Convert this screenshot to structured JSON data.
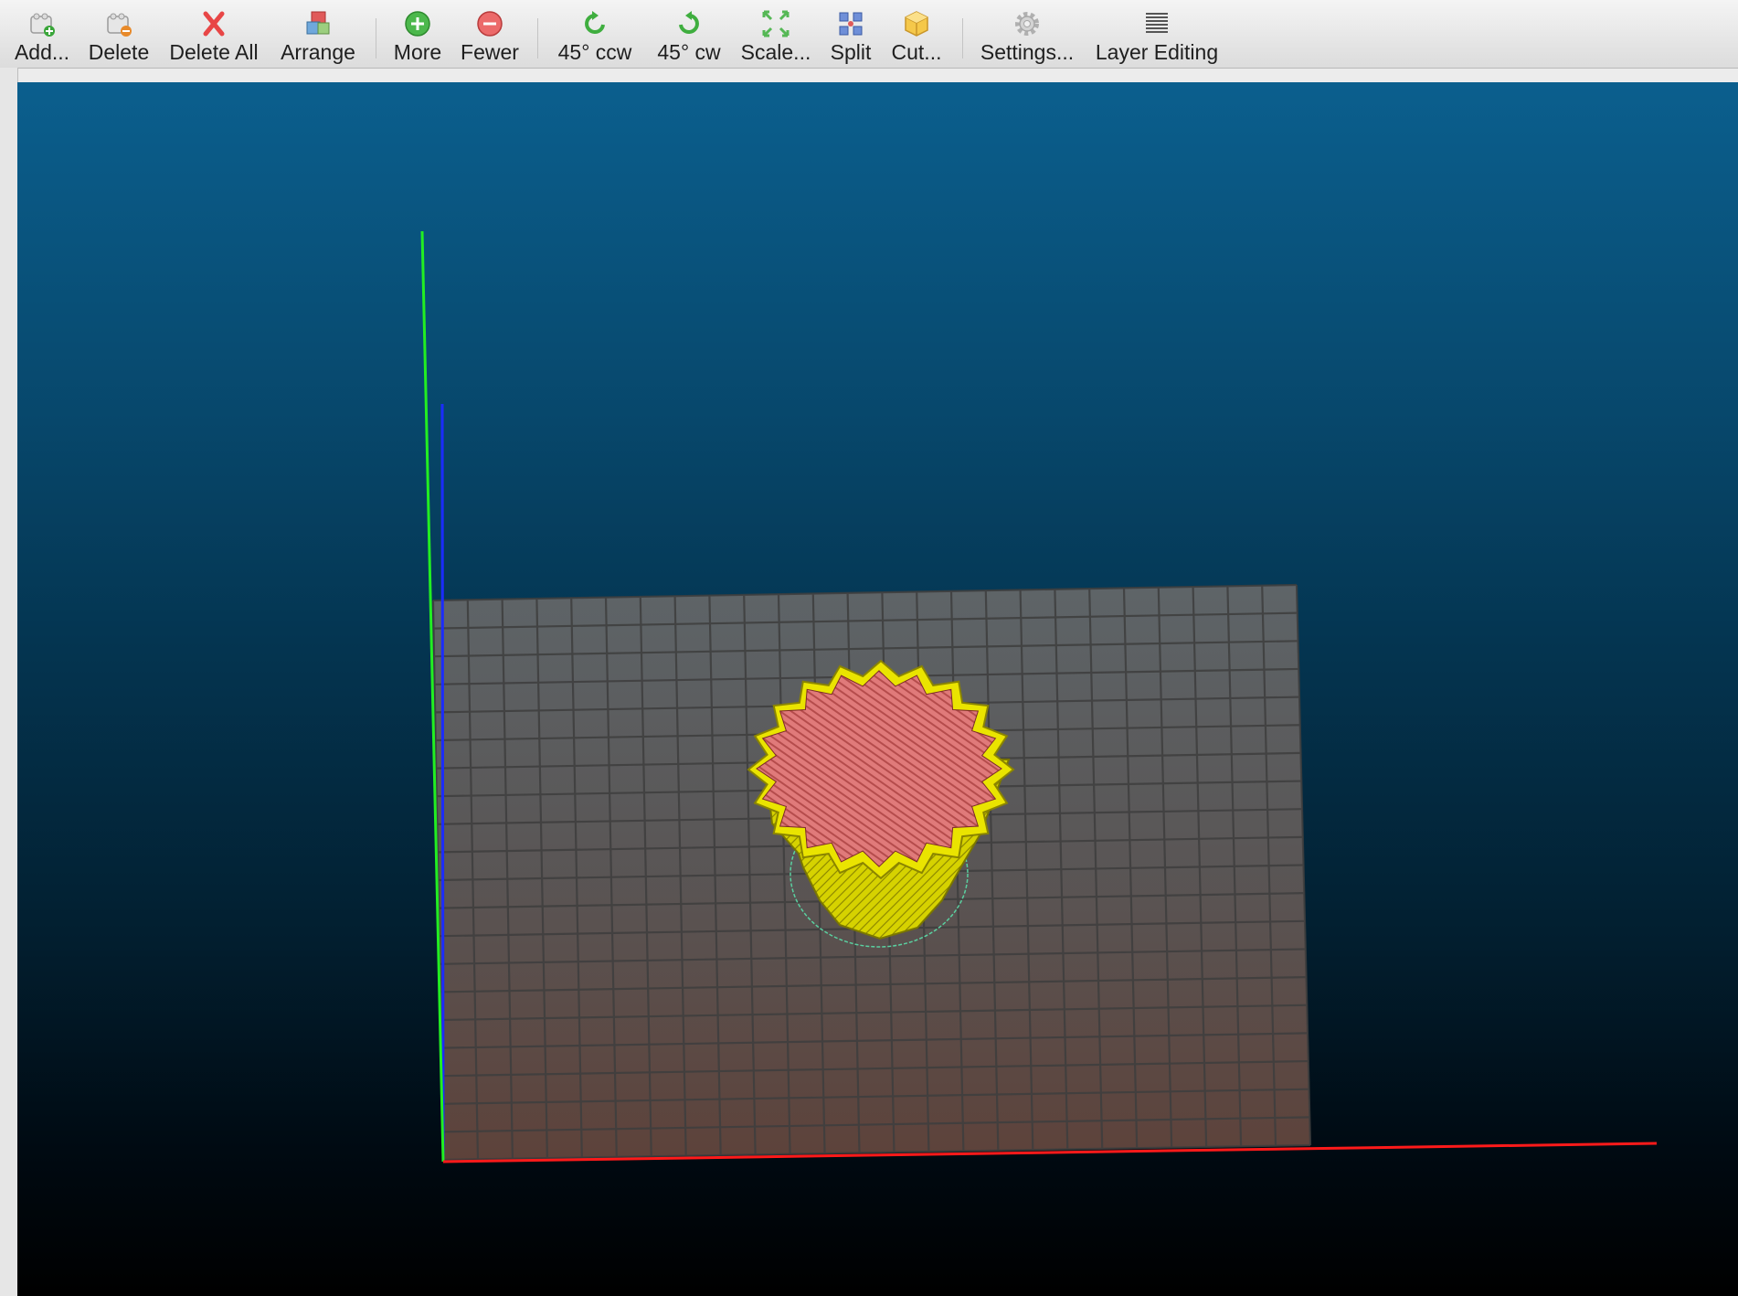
{
  "toolbar": {
    "buttons": [
      {
        "label": "Add...",
        "icon": "add-object-icon"
      },
      {
        "label": "Delete",
        "icon": "delete-object-icon"
      },
      {
        "label": "Delete All",
        "icon": "delete-all-icon"
      },
      {
        "label": "Arrange",
        "icon": "arrange-icon"
      },
      {
        "label": "More",
        "icon": "more-copies-icon"
      },
      {
        "label": "Fewer",
        "icon": "fewer-copies-icon"
      },
      {
        "label": "45° ccw",
        "icon": "rotate-ccw-icon"
      },
      {
        "label": "45° cw",
        "icon": "rotate-cw-icon"
      },
      {
        "label": "Scale...",
        "icon": "scale-icon"
      },
      {
        "label": "Split",
        "icon": "split-icon"
      },
      {
        "label": "Cut...",
        "icon": "cut-icon"
      },
      {
        "label": "Settings...",
        "icon": "settings-gear-icon"
      },
      {
        "label": "Layer Editing",
        "icon": "layer-editing-icon"
      }
    ]
  },
  "viewport": {
    "background_top": "#0b5f8e",
    "background_bottom": "#000000",
    "bed_color": "#6e6e6e",
    "axis_colors": {
      "x": "#ff1a1a",
      "y": "#22ee22",
      "z": "#1b2cff"
    },
    "object_colors": {
      "side": "#e4e000",
      "top": "#d97272"
    }
  }
}
